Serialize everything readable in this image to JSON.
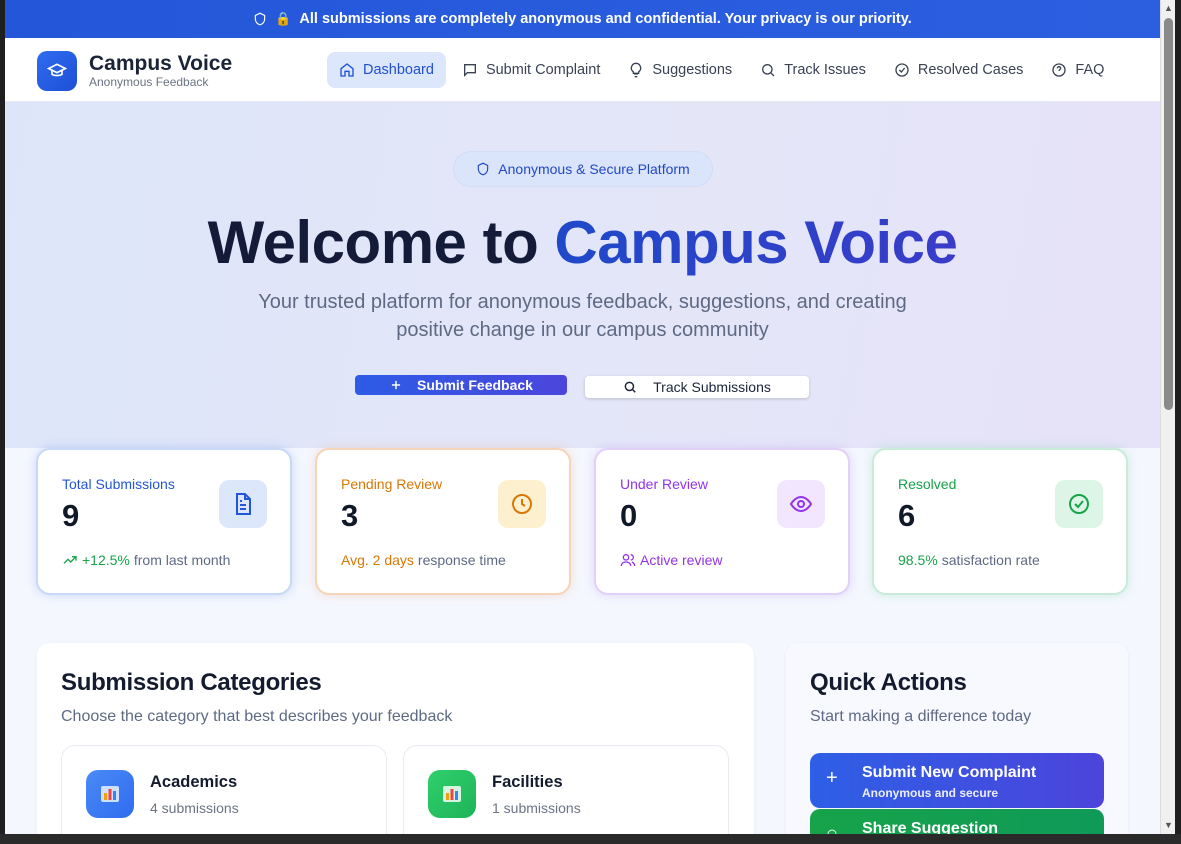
{
  "banner": {
    "text": "All submissions are completely anonymous and confidential. Your privacy is our priority."
  },
  "brand": {
    "title": "Campus Voice",
    "subtitle": "Anonymous Feedback"
  },
  "nav": {
    "items": [
      {
        "label": "Dashboard",
        "icon": "home-icon"
      },
      {
        "label": "Submit Complaint",
        "icon": "message-icon"
      },
      {
        "label": "Suggestions",
        "icon": "lightbulb-icon"
      },
      {
        "label": "Track Issues",
        "icon": "search-icon"
      },
      {
        "label": "Resolved Cases",
        "icon": "check-circle-icon"
      },
      {
        "label": "FAQ",
        "icon": "help-circle-icon"
      }
    ]
  },
  "hero": {
    "pill": "Anonymous & Secure Platform",
    "title_part1": "Welcome to",
    "title_part2": "Campus Voice",
    "subtitle": "Your trusted platform for anonymous feedback, suggestions, and creating positive change in our campus community",
    "primary_button": "Submit Feedback",
    "secondary_button": "Track Submissions"
  },
  "stats": [
    {
      "label": "Total Submissions",
      "value": "9",
      "foot_highlight": "+12.5%",
      "foot_text": "from last month",
      "color": "#2456d9"
    },
    {
      "label": "Pending Review",
      "value": "3",
      "foot_highlight": "Avg. 2 days",
      "foot_text": "response time",
      "color": "#d97706"
    },
    {
      "label": "Under Review",
      "value": "0",
      "foot_highlight": "Active review",
      "foot_text": "",
      "color": "#9333ea"
    },
    {
      "label": "Resolved",
      "value": "6",
      "foot_highlight": "98.5%",
      "foot_text": "satisfaction rate",
      "color": "#16a34a"
    }
  ],
  "categories": {
    "title": "Submission Categories",
    "subtitle": "Choose the category that best describes your feedback",
    "items": [
      {
        "name": "Academics",
        "count": "4 submissions"
      },
      {
        "name": "Facilities",
        "count": "1 submissions"
      }
    ]
  },
  "quick_actions": {
    "title": "Quick Actions",
    "subtitle": "Start making a difference today",
    "items": [
      {
        "title": "Submit New Complaint",
        "subtitle": "Anonymous and secure"
      },
      {
        "title": "Share Suggestion",
        "subtitle": ""
      }
    ]
  }
}
